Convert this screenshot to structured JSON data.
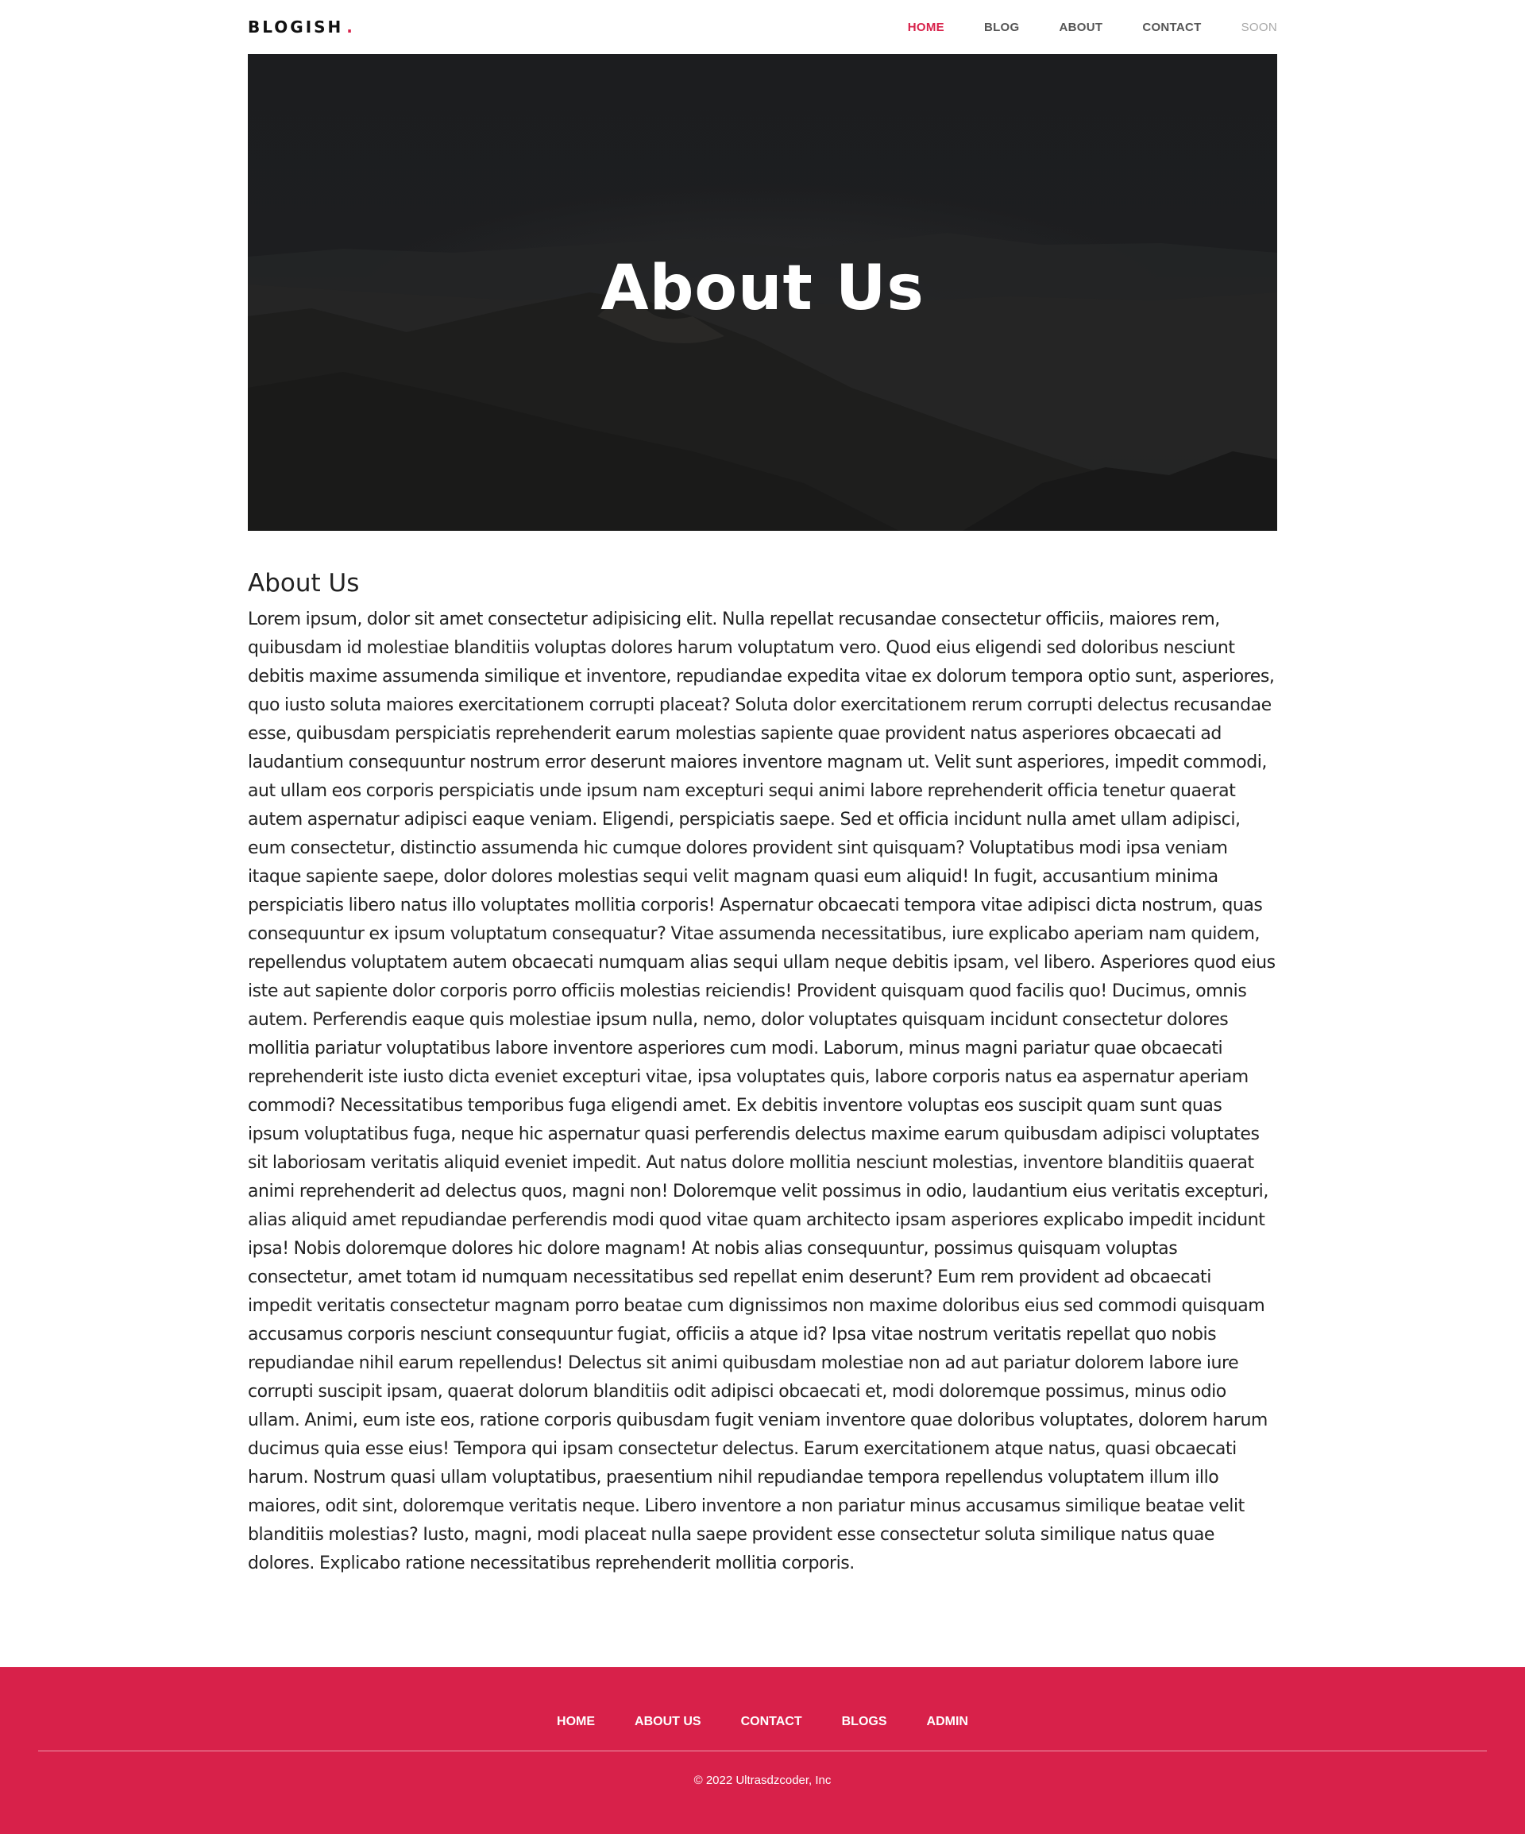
{
  "header": {
    "logo": "BLOGISH",
    "logo_dot": ".",
    "nav": [
      {
        "label": "HOME",
        "state": "active"
      },
      {
        "label": "BLOG",
        "state": "normal"
      },
      {
        "label": "ABOUT",
        "state": "normal"
      },
      {
        "label": "CONTACT",
        "state": "normal"
      },
      {
        "label": "SOON",
        "state": "muted"
      }
    ]
  },
  "hero": {
    "title": "About Us"
  },
  "content": {
    "heading": "About Us",
    "body": "Lorem ipsum, dolor sit amet consectetur adipisicing elit. Nulla repellat recusandae consectetur officiis, maiores rem, quibusdam id molestiae blanditiis voluptas dolores harum voluptatum vero. Quod eius eligendi sed doloribus nesciunt debitis maxime assumenda similique et inventore, repudiandae expedita vitae ex dolorum tempora optio sunt, asperiores, quo iusto soluta maiores exercitationem corrupti placeat? Soluta dolor exercitationem rerum corrupti delectus recusandae esse, quibusdam perspiciatis reprehenderit earum molestias sapiente quae provident natus asperiores obcaecati ad laudantium consequuntur nostrum error deserunt maiores inventore magnam ut. Velit sunt asperiores, impedit commodi, aut ullam eos corporis perspiciatis unde ipsum nam excepturi sequi animi labore reprehenderit officia tenetur quaerat autem aspernatur adipisci eaque veniam. Eligendi, perspiciatis saepe. Sed et officia incidunt nulla amet ullam adipisci, eum consectetur, distinctio assumenda hic cumque dolores provident sint quisquam? Voluptatibus modi ipsa veniam itaque sapiente saepe, dolor dolores molestias sequi velit magnam quasi eum aliquid! In fugit, accusantium minima perspiciatis libero natus illo voluptates mollitia corporis! Aspernatur obcaecati tempora vitae adipisci dicta nostrum, quas consequuntur ex ipsum voluptatum consequatur? Vitae assumenda necessitatibus, iure explicabo aperiam nam quidem, repellendus voluptatem autem obcaecati numquam alias sequi ullam neque debitis ipsam, vel libero. Asperiores quod eius iste aut sapiente dolor corporis porro officiis molestias reiciendis! Provident quisquam quod facilis quo! Ducimus, omnis autem. Perferendis eaque quis molestiae ipsum nulla, nemo, dolor voluptates quisquam incidunt consectetur dolores mollitia pariatur voluptatibus labore inventore asperiores cum modi. Laborum, minus magni pariatur quae obcaecati reprehenderit iste iusto dicta eveniet excepturi vitae, ipsa voluptates quis, labore corporis natus ea aspernatur aperiam commodi? Necessitatibus temporibus fuga eligendi amet. Ex debitis inventore voluptas eos suscipit quam sunt quas ipsum voluptatibus fuga, neque hic aspernatur quasi perferendis delectus maxime earum quibusdam adipisci voluptates sit laboriosam veritatis aliquid eveniet impedit. Aut natus dolore mollitia nesciunt molestias, inventore blanditiis quaerat animi reprehenderit ad delectus quos, magni non! Doloremque velit possimus in odio, laudantium eius veritatis excepturi, alias aliquid amet repudiandae perferendis modi quod vitae quam architecto ipsam asperiores explicabo impedit incidunt ipsa! Nobis doloremque dolores hic dolore magnam! At nobis alias consequuntur, possimus quisquam voluptas consectetur, amet totam id numquam necessitatibus sed repellat enim deserunt? Eum rem provident ad obcaecati impedit veritatis consectetur magnam porro beatae cum dignissimos non maxime doloribus eius sed commodi quisquam accusamus corporis nesciunt consequuntur fugiat, officiis a atque id? Ipsa vitae nostrum veritatis repellat quo nobis repudiandae nihil earum repellendus! Delectus sit animi quibusdam molestiae non ad aut pariatur dolorem labore iure corrupti suscipit ipsam, quaerat dolorum blanditiis odit adipisci obcaecati et, modi doloremque possimus, minus odio ullam. Animi, eum iste eos, ratione corporis quibusdam fugit veniam inventore quae doloribus voluptates, dolorem harum ducimus quia esse eius! Tempora qui ipsam consectetur delectus. Earum exercitationem atque natus, quasi obcaecati harum. Nostrum quasi ullam voluptatibus, praesentium nihil repudiandae tempora repellendus voluptatem illum illo maiores, odit sint, doloremque veritatis neque. Libero inventore a non pariatur minus accusamus similique beatae velit blanditiis molestias? Iusto, magni, modi placeat nulla saepe provident esse consectetur soluta similique natus quae dolores. Explicabo ratione necessitatibus reprehenderit mollitia corporis."
  },
  "footer": {
    "links": [
      "HOME",
      "ABOUT US",
      "CONTACT",
      "BLOGS",
      "ADMIN"
    ],
    "copyright": "© 2022 Ultrasdzcoder, Inc"
  },
  "colors": {
    "accent": "#d8214a",
    "hero_bg": "#1c1d1f",
    "text": "#222222",
    "nav_text": "#555555",
    "nav_muted": "#a8a8a8"
  }
}
